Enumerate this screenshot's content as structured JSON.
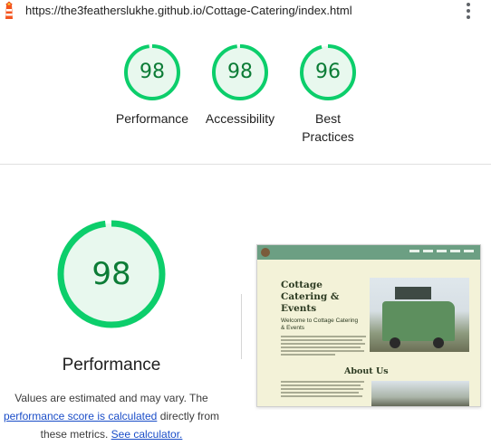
{
  "url_bar": {
    "url": "https://the3featherslukhe.github.io/Cottage-Catering/index.html",
    "logo_icon": "lighthouse-icon",
    "menu_icon": "kebab-menu-icon"
  },
  "summary_gauges": [
    {
      "score": "98",
      "label": "Performance"
    },
    {
      "score": "98",
      "label": "Accessibility"
    },
    {
      "score": "96",
      "label": "Best Practices"
    }
  ],
  "performance": {
    "score": "98",
    "title": "Performance",
    "note_prefix": "Values are estimated and may vary. The",
    "link_score": "performance score is calculated",
    "note_middle": "directly from",
    "note_suffix": "these metrics.",
    "link_calculator": "See calculator."
  },
  "thumbnail": {
    "heading_line1": "Cottage",
    "heading_line2": "Catering &",
    "heading_line3": "Events",
    "subheading": "Welcome to Cottage Catering & Events",
    "about_heading": "About Us"
  },
  "colors": {
    "pass_green": "#0cce6b",
    "pass_text": "#0c7c36",
    "pass_fill": "#e8f8ee",
    "link_blue": "#1a4dc8"
  }
}
